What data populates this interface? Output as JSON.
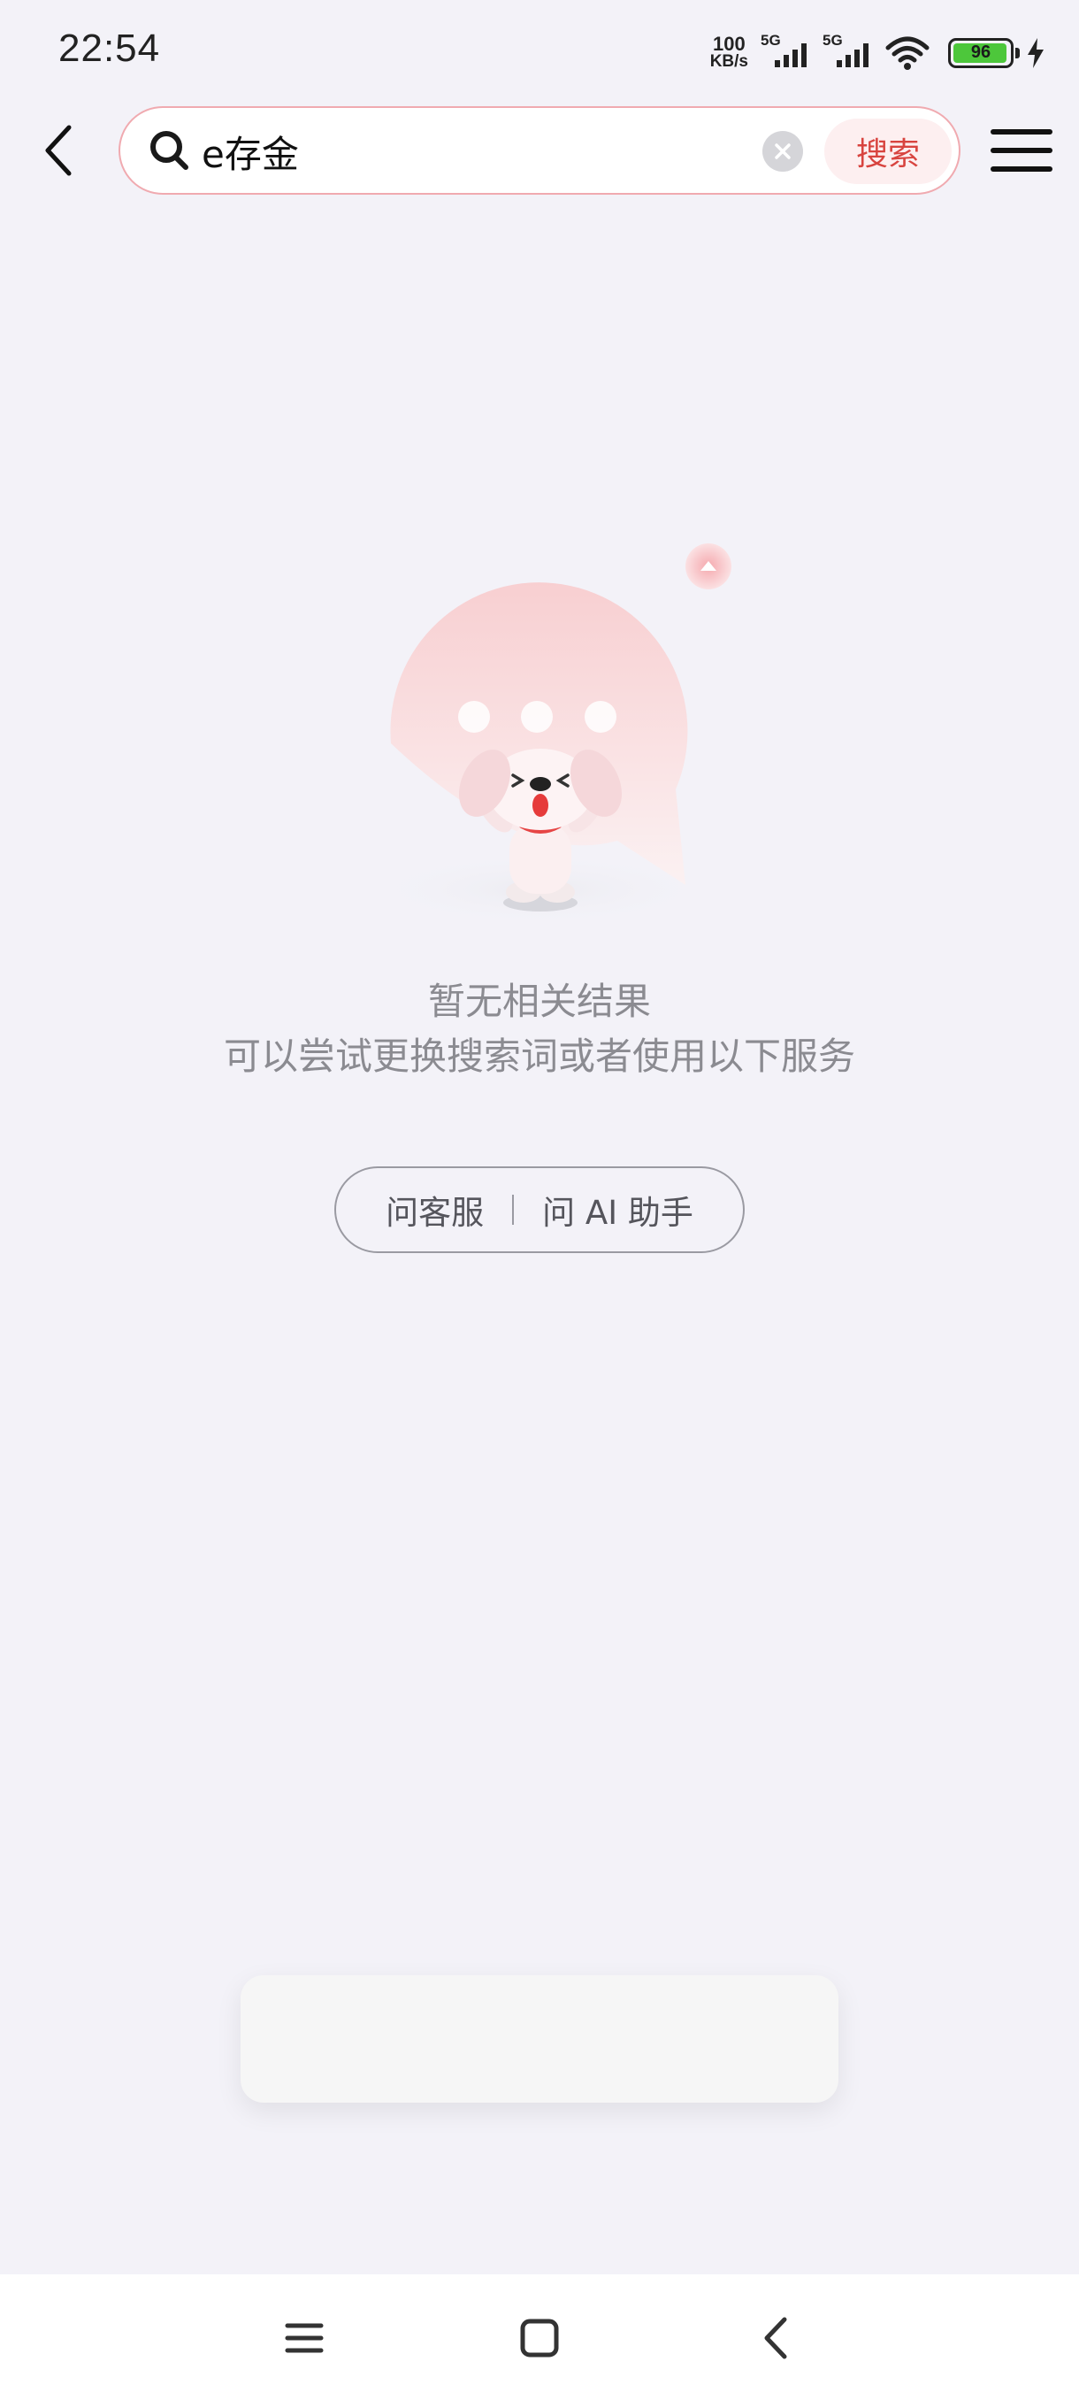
{
  "status_bar": {
    "time": "22:54",
    "net_speed_value": "100",
    "net_speed_unit": "KB/s",
    "signal_1_label": "5G",
    "signal_2_label": "5G",
    "wifi_icon": "wifi-icon",
    "battery_level": "96",
    "battery_fraction": 0.96,
    "charging_icon": "bolt-icon"
  },
  "header": {
    "back_icon": "chevron-left-icon",
    "search_icon": "search-icon",
    "search_value": "e存金",
    "clear_icon": "clear-circle-icon",
    "search_button_label": "搜索",
    "menu_icon": "hamburger-menu-icon"
  },
  "empty_state": {
    "title": "暂无相关结果",
    "subtitle": "可以尝试更换搜索词或者使用以下服务",
    "actions": {
      "customer_service_label": "问客服",
      "ai_assistant_label": "问 AI 助手"
    }
  },
  "nav_bar": {
    "recent_apps_icon": "menu-lines-icon",
    "home_icon": "square-home-icon",
    "back_icon": "chevron-left-icon"
  },
  "colors": {
    "background": "#f3f2f8",
    "accent": "#d8443f",
    "search_border": "#f0aab0"
  }
}
